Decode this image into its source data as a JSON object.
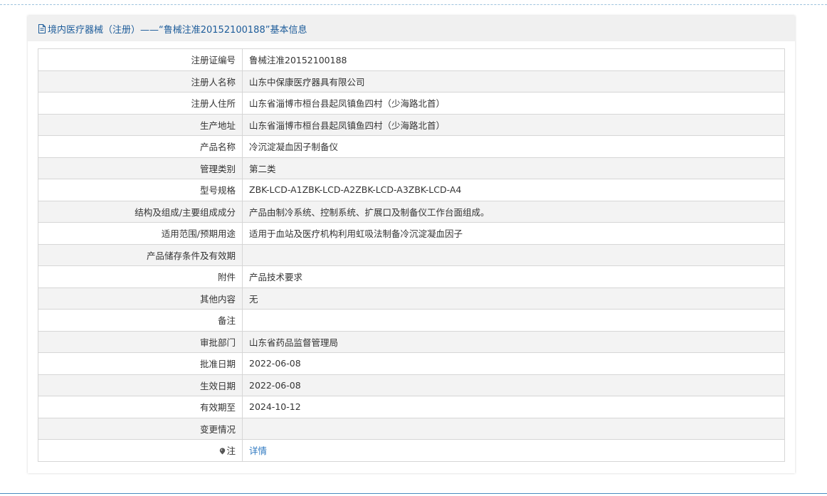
{
  "header": {
    "title": "境内医疗器械（注册）——“鲁械注准20152100188”基本信息"
  },
  "rows": [
    {
      "label": "注册证编号",
      "value": "鲁械注准20152100188"
    },
    {
      "label": "注册人名称",
      "value": "山东中保康医疗器具有限公司"
    },
    {
      "label": "注册人住所",
      "value": "山东省淄博市桓台县起凤镇鱼四村（少海路北首）"
    },
    {
      "label": "生产地址",
      "value": "山东省淄博市桓台县起凤镇鱼四村（少海路北首）"
    },
    {
      "label": "产品名称",
      "value": "冷沉淀凝血因子制备仪"
    },
    {
      "label": "管理类别",
      "value": "第二类"
    },
    {
      "label": "型号规格",
      "value": "ZBK-LCD-A1ZBK-LCD-A2ZBK-LCD-A3ZBK-LCD-A4"
    },
    {
      "label": "结构及组成/主要组成成分",
      "value": "产品由制冷系统、控制系统、扩展口及制备仪工作台面组成。"
    },
    {
      "label": "适用范围/预期用途",
      "value": "适用于血站及医疗机构利用虹吸法制备冷沉淀凝血因子"
    },
    {
      "label": "产品储存条件及有效期",
      "value": ""
    },
    {
      "label": "附件",
      "value": "产品技术要求"
    },
    {
      "label": "其他内容",
      "value": "无"
    },
    {
      "label": "备注",
      "value": ""
    },
    {
      "label": "审批部门",
      "value": "山东省药品监督管理局"
    },
    {
      "label": "批准日期",
      "value": "2022-06-08"
    },
    {
      "label": "生效日期",
      "value": "2022-06-08"
    },
    {
      "label": "有效期至",
      "value": "2024-10-12"
    },
    {
      "label": "变更情况",
      "value": ""
    }
  ],
  "note_row": {
    "label": "注",
    "link_text": "详情",
    "icon": "note-pin-icon"
  },
  "colors": {
    "header_text": "#1d5c9a",
    "link": "#2f79c1",
    "row_alt": "#f3f3f3",
    "border": "#d6d6d6"
  }
}
